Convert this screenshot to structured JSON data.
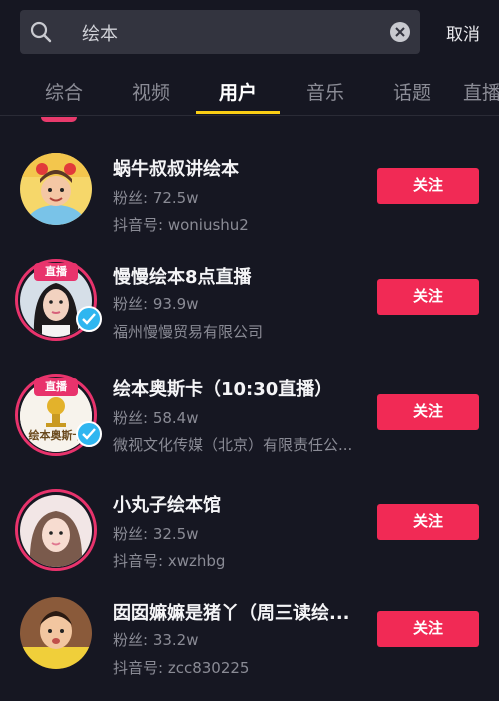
{
  "search": {
    "query": "绘本",
    "action_label": "取消"
  },
  "tabs": [
    {
      "label": "综合"
    },
    {
      "label": "视频"
    },
    {
      "label": "用户"
    },
    {
      "label": "音乐"
    },
    {
      "label": "话题"
    },
    {
      "label": "直播"
    }
  ],
  "active_tab": "用户",
  "users": [
    {
      "name": "蜗牛叔叔讲绘本",
      "fans": "粉丝: 72.5w",
      "sub": "抖音号: woniushu2",
      "live": "",
      "verified": false,
      "follow_label": "关注"
    },
    {
      "name": "慢慢绘本8点直播",
      "fans": "粉丝: 93.9w",
      "sub": "福州慢慢贸易有限公司",
      "live": "直播",
      "verified": true,
      "follow_label": "关注"
    },
    {
      "name": "绘本奥斯卡（10:30直播）",
      "fans": "粉丝: 58.4w",
      "sub": "微视文化传媒（北京）有限责任公...",
      "live": "直播",
      "verified": true,
      "avatar_text": "绘本奥斯卡",
      "follow_label": "关注"
    },
    {
      "name": "小丸子绘本馆",
      "fans": "粉丝: 32.5w",
      "sub": "抖音号: xwzhbg",
      "live": "",
      "verified": false,
      "follow_label": "关注"
    },
    {
      "name": "囡囡嫲嫲是猪丫（周三读绘...",
      "fans": "粉丝: 33.2w",
      "sub": "抖音号: zcc830225",
      "live": "",
      "verified": false,
      "follow_label": "关注"
    }
  ],
  "colors": {
    "background": "#161722",
    "accent": "#face15",
    "follow": "#f12a55",
    "live_ring": "#e8336c",
    "verified": "#2fb6f0"
  }
}
